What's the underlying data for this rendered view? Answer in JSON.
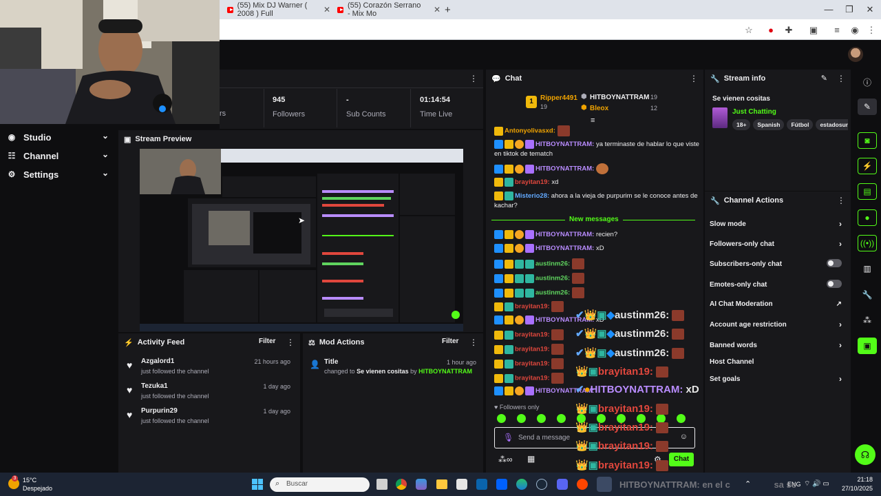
{
  "browser": {
    "tabs": [
      {
        "label": "(55) Mix DJ Warner ( 2008 ) Full"
      },
      {
        "label": "(55) Corazón Serrano - Mix Mo"
      }
    ],
    "new_tab": "+"
  },
  "nav": {
    "items": [
      {
        "label": "Studio"
      },
      {
        "label": "Channel"
      },
      {
        "label": "Settings"
      }
    ]
  },
  "stats": {
    "partial_label": "rs",
    "followers_value": "945",
    "followers_label": "Followers",
    "subs_value": "-",
    "subs_label": "Sub Counts",
    "time_value": "01:14:54",
    "time_label": "Time Live"
  },
  "preview": {
    "title": "Stream Preview"
  },
  "activity": {
    "title": "Activity Feed",
    "filter": "Filter",
    "items": [
      {
        "name": "Azgalord1",
        "desc": "just followed the channel",
        "time": "21 hours ago"
      },
      {
        "name": "Tezuka1",
        "desc": "just followed the channel",
        "time": "1 day ago"
      },
      {
        "name": "Purpurin29",
        "desc": "just followed the channel",
        "time": "1 day ago"
      }
    ]
  },
  "mod": {
    "title": "Mod Actions",
    "filter": "Filter",
    "item_title": "Title",
    "item_time": "1 hour ago",
    "item_prefix": "changed to",
    "item_value": "Se vienen cositas",
    "item_by": "by",
    "item_user": "HITBOYNATTRAM"
  },
  "chat": {
    "title": "Chat",
    "top1_rank": "1",
    "top1_name": "Ripper4491",
    "top1_count": "19",
    "top2_name": "HITBOYNATTRAM",
    "top2_count": "19",
    "top3_name": "Bleox",
    "top3_count": "12",
    "new_messages": "New messages",
    "followers_only": "Followers only",
    "send_placeholder": "Send a message",
    "chat_button": "Chat",
    "messages": [
      {
        "user": "Antonyolivasxd:",
        "text": ""
      },
      {
        "user": "HITBOYNATTRAM:",
        "text": "ya terminaste de hablar lo que viste en tiktok de tematch"
      },
      {
        "user": "HITBOYNATTRAM:",
        "text": ""
      },
      {
        "user": "brayitan19:",
        "text": "xd"
      },
      {
        "user": "Misterio28:",
        "text": "ahora a la vieja de purpurim se le conoce antes de kachar?"
      },
      {
        "user": "HITBOYNATTRAM:",
        "text": "recien?"
      },
      {
        "user": "HITBOYNATTRAM:",
        "text": "xD"
      },
      {
        "user": "austinm26:",
        "text": ""
      },
      {
        "user": "austinm26:",
        "text": ""
      },
      {
        "user": "austinm26:",
        "text": ""
      },
      {
        "user": "brayitan19:",
        "text": ""
      },
      {
        "user": "HITBOYNATTRAM:",
        "text": "xD"
      },
      {
        "user": "brayitan19:",
        "text": ""
      },
      {
        "user": "brayitan19:",
        "text": ""
      },
      {
        "user": "brayitan19:",
        "text": ""
      },
      {
        "user": "brayitan19:",
        "text": ""
      },
      {
        "user": "HITBOYNATTRAM:",
        "text": ""
      }
    ],
    "overlay": [
      {
        "user": "austinm26:"
      },
      {
        "user": "austinm26:"
      },
      {
        "user": "austinm26:"
      },
      {
        "user": "brayitan19:"
      },
      {
        "user": "HITBOYNATTRAM:",
        "text": "xD"
      },
      {
        "user": "brayitan19:"
      },
      {
        "user": "brayitan19:"
      },
      {
        "user": "brayitan19:"
      },
      {
        "user": "brayitan19:"
      }
    ],
    "overlay_tail": "HITBOYNATTRAM: en el c",
    "overlay_tail2": "sa se"
  },
  "streaminfo": {
    "title": "Stream info",
    "stream_title": "Se vienen cositas",
    "category": "Just Chatting",
    "tags": [
      "18+",
      "Spanish",
      "Fútbol",
      "estadosun"
    ]
  },
  "actions": {
    "title": "Channel Actions",
    "items": [
      {
        "label": "Slow mode"
      },
      {
        "label": "Followers-only chat"
      },
      {
        "label": "Subscribers-only chat"
      },
      {
        "label": "Emotes-only chat"
      },
      {
        "label": "AI Chat Moderation"
      },
      {
        "label": "Account age restriction"
      },
      {
        "label": "Banned words"
      },
      {
        "label": "Host Channel"
      },
      {
        "label": "Set goals"
      }
    ]
  },
  "taskbar": {
    "weather_temp": "15°C",
    "weather_desc": "Despejado",
    "search_placeholder": "Buscar",
    "lang": "ENG",
    "time": "21:18",
    "date": "27/10/2025",
    "notif_count": "3"
  },
  "colors": {
    "accent": "#53fc18",
    "panel": "#18181b",
    "bg": "#0e0e10"
  }
}
